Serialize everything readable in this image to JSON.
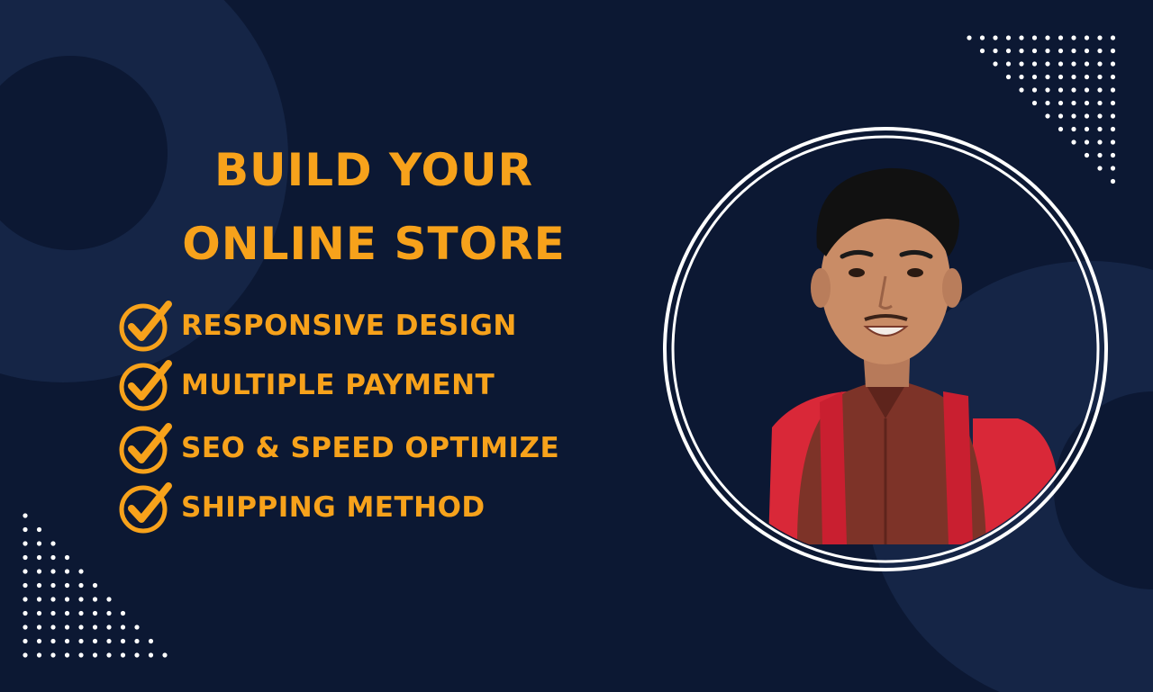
{
  "headline": {
    "line1": "BUILD YOUR",
    "line2": "ONLINE STORE"
  },
  "features": [
    {
      "label": "RESPONSIVE DESIGN",
      "icon": "checkmark-circle-icon"
    },
    {
      "label": "MULTIPLE PAYMENT",
      "icon": "checkmark-circle-icon"
    },
    {
      "label": "SEO & SPEED OPTIMIZE",
      "icon": "checkmark-circle-icon"
    },
    {
      "label": "SHIPPING METHOD",
      "icon": "checkmark-circle-icon"
    }
  ],
  "colors": {
    "background": "#0c1833",
    "accent": "#f7a21b",
    "ring": "#ffffff",
    "shirt": "#7d3328",
    "backpack": "#d92838"
  }
}
